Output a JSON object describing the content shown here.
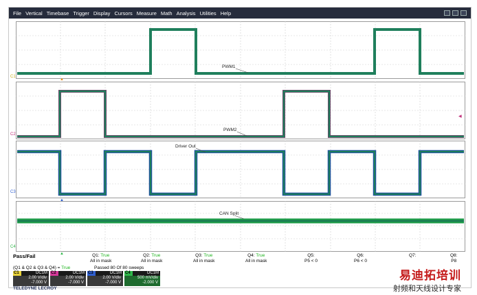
{
  "menu": [
    "File",
    "Vertical",
    "Timebase",
    "Trigger",
    "Display",
    "Cursors",
    "Measure",
    "Math",
    "Analysis",
    "Utilities",
    "Help"
  ],
  "traces": {
    "t1": {
      "label": "PWM1",
      "color": "#1f7f5c"
    },
    "t2": {
      "label": "PWM2",
      "color": "#7a3a6a"
    },
    "t3": {
      "label": "Driver Out",
      "color": "#1d4fa0"
    },
    "t4": {
      "label": "CAN Split",
      "color": "#1e9a4a"
    }
  },
  "channel_markers": [
    "C1",
    "C2",
    "C3",
    "C4"
  ],
  "passfail": {
    "title": "Pass/Fail",
    "items": [
      {
        "name": "Q1:",
        "value": "True",
        "sub": "All in mask"
      },
      {
        "name": "Q2:",
        "value": "True",
        "sub": "All in mask"
      },
      {
        "name": "Q3:",
        "value": "True",
        "sub": "All in mask"
      },
      {
        "name": "Q4:",
        "value": "True",
        "sub": "All in mask"
      },
      {
        "name": "Q5:",
        "value": "",
        "sub": "P5 < 0"
      },
      {
        "name": "Q6:",
        "value": "",
        "sub": "P6 < 0"
      },
      {
        "name": "Q7:",
        "value": "",
        "sub": ""
      },
      {
        "name": "Q8:",
        "value": "",
        "sub": "P8"
      }
    ]
  },
  "condition": {
    "text": "(Q1 & Q2 & Q3 & Q4) =",
    "value": "True"
  },
  "passed": {
    "label": "Passed",
    "count": "80",
    "of": "Of 80",
    "unit": "sweeps"
  },
  "channels": [
    {
      "tag": "C1",
      "mode": "DC1M",
      "vdiv": "2.00 V/div",
      "offset": "-7.000 V",
      "color": "#e8d23a"
    },
    {
      "tag": "C2",
      "mode": "DC1M",
      "vdiv": "2.00 V/div",
      "offset": "-7.000 V",
      "color": "#d6389a"
    },
    {
      "tag": "C3",
      "mode": "DC1M",
      "vdiv": "2.00 V/div",
      "offset": "-7.000 V",
      "color": "#2f5fd0"
    },
    {
      "tag": "C4",
      "mode": "DC1M",
      "vdiv": "500 mV/div",
      "offset": "-2.000 V",
      "color": "#2fb84a"
    }
  ],
  "brand": "TELEDYNE LECROY",
  "watermark": {
    "line1": "易迪拓培训",
    "line2": "射频和天线设计专家"
  }
}
